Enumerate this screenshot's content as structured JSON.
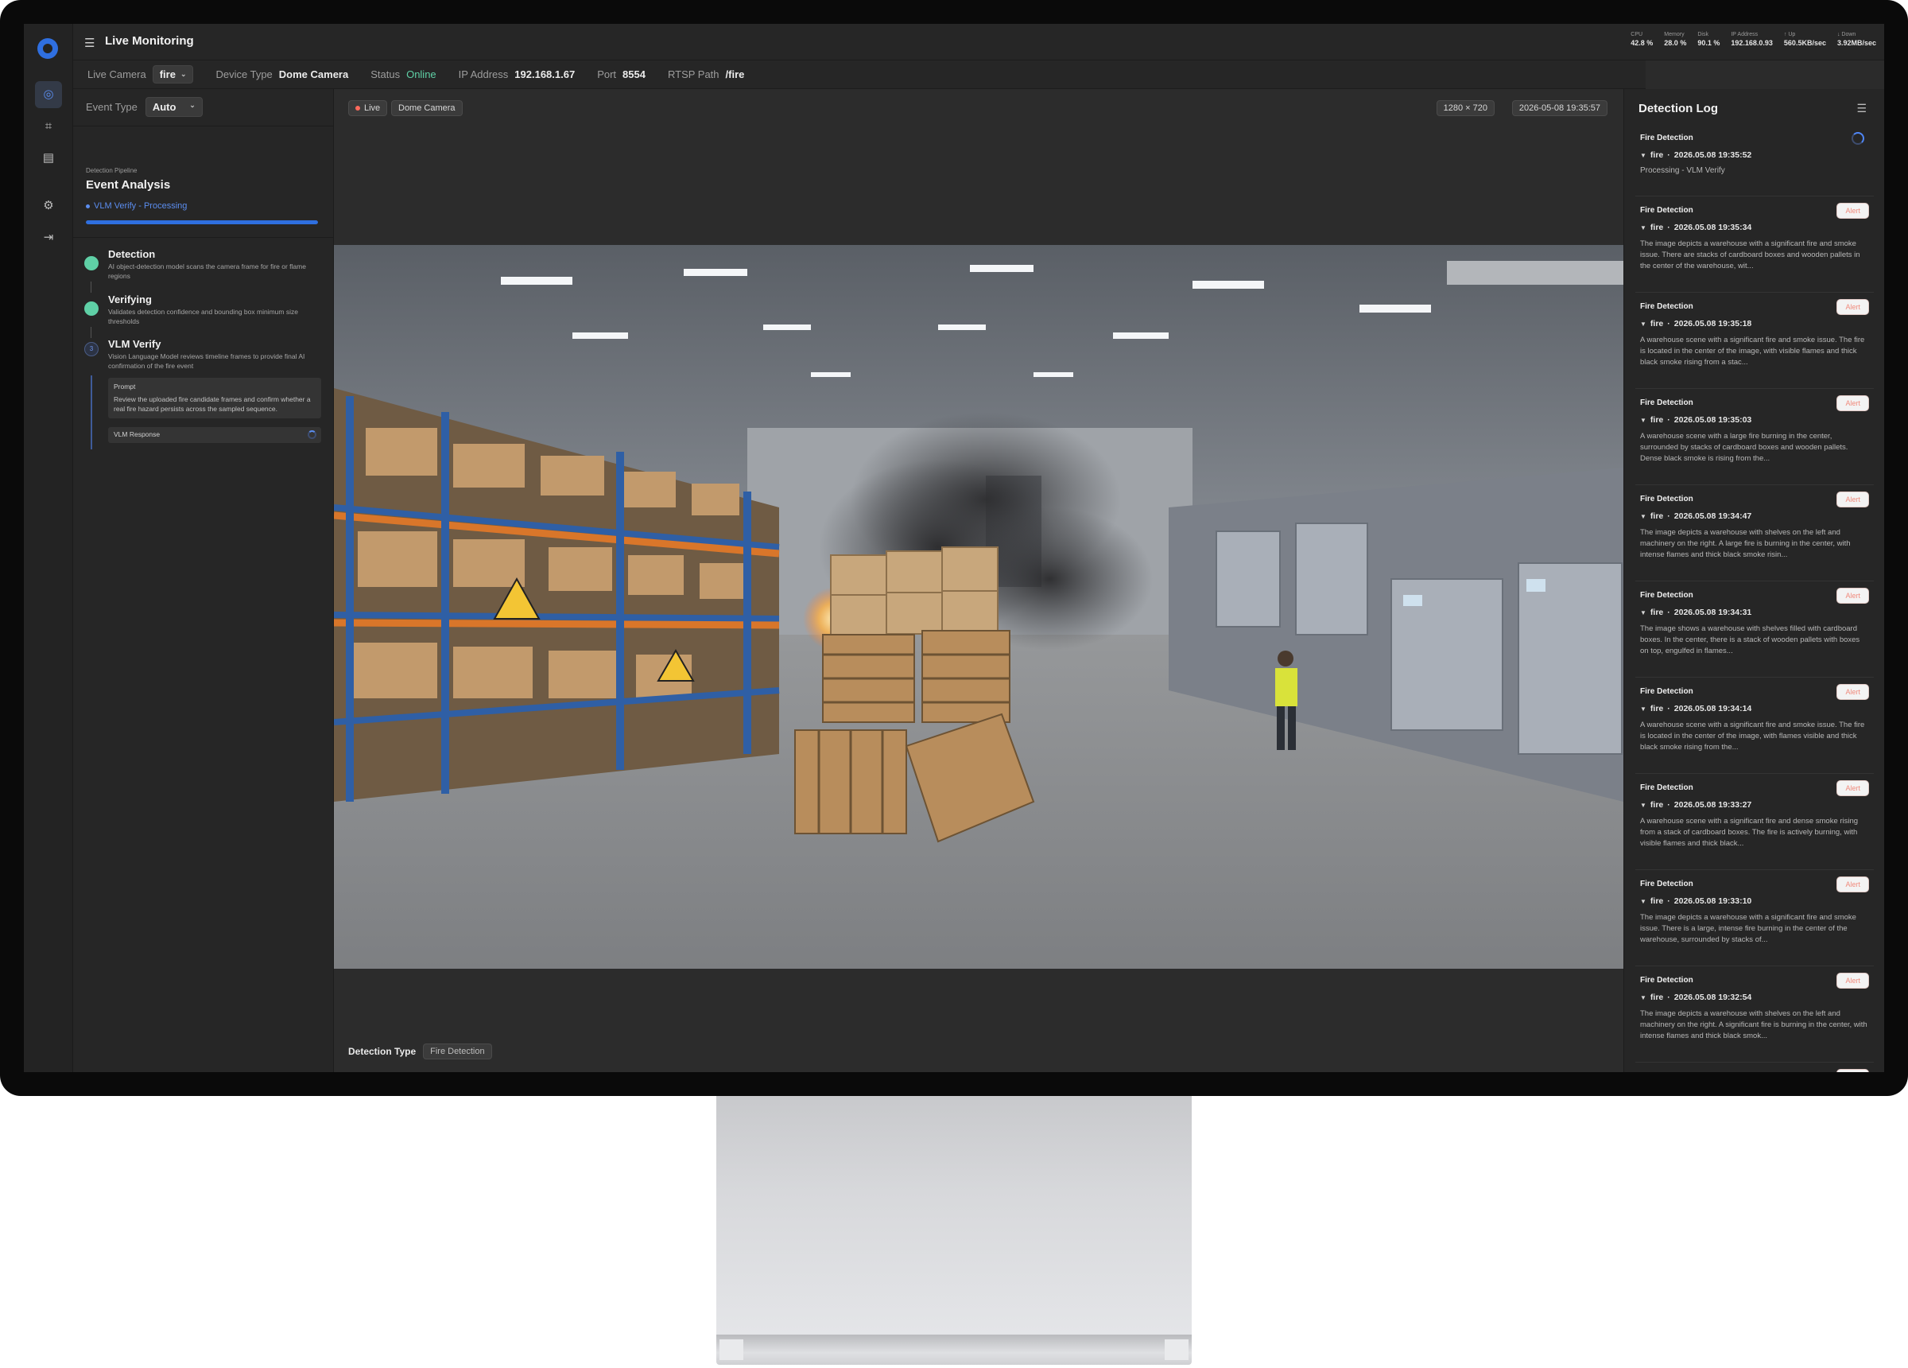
{
  "app": {
    "title": "Live Monitoring"
  },
  "system_stats": [
    {
      "label": "CPU",
      "value": "42.8 %"
    },
    {
      "label": "Memory",
      "value": "28.0 %"
    },
    {
      "label": "Disk",
      "value": "90.1 %"
    },
    {
      "label": "IP Address",
      "value": "192.168.0.93"
    },
    {
      "label": "↑ Up",
      "value": "560.5KB/sec"
    },
    {
      "label": "↓ Down",
      "value": "3.92MB/sec"
    }
  ],
  "camera_info": {
    "live_camera_label": "Live Camera",
    "live_camera_value": "fire",
    "device_type_label": "Device Type",
    "device_type_value": "Dome Camera",
    "status_label": "Status",
    "status_value": "Online",
    "ip_label": "IP Address",
    "ip_value": "192.168.1.67",
    "port_label": "Port",
    "port_value": "8554",
    "rtsp_label": "RTSP Path",
    "rtsp_value": "/fire"
  },
  "left_panel": {
    "event_type_label": "Event Type",
    "event_type_value": "Auto",
    "pipeline_kicker": "Detection Pipeline",
    "pipeline_title": "Event Analysis",
    "pipeline_status": "VLM Verify - Processing",
    "progress_fraction": 1.0,
    "steps": [
      {
        "name": "Detection",
        "desc": "AI object-detection model scans the camera frame for fire or flame regions",
        "state": "done"
      },
      {
        "name": "Verifying",
        "desc": "Validates detection confidence and bounding box minimum size thresholds",
        "state": "done"
      },
      {
        "name": "VLM Verify",
        "desc": "Vision Language Model reviews timeline frames to provide final AI confirmation of the fire event",
        "state": "current",
        "number": "3"
      }
    ],
    "prompt_label": "Prompt",
    "prompt_text": "Review the uploaded fire candidate frames and confirm whether a real fire hazard persists across the sampled sequence.",
    "vlm_response_label": "VLM Response"
  },
  "video": {
    "live_tag": "Live",
    "camera_tag": "Dome Camera",
    "resolution": "1280 × 720",
    "timestamp": "2026-05-08 19:35:57",
    "detection_type_label": "Detection Type",
    "detection_type_value": "Fire Detection"
  },
  "detection_log": {
    "title": "Detection Log",
    "alert_label": "Alert",
    "items": [
      {
        "title": "Fire Detection",
        "camera": "fire",
        "time": "2026.05.08 19:35:52",
        "status": "Processing - VLM Verify",
        "processing": true
      },
      {
        "title": "Fire Detection",
        "camera": "fire",
        "time": "2026.05.08 19:35:34",
        "text": "The image depicts a warehouse with a significant fire and smoke issue. There are stacks of cardboard boxes and wooden pallets in the center of the warehouse, wit..."
      },
      {
        "title": "Fire Detection",
        "camera": "fire",
        "time": "2026.05.08 19:35:18",
        "text": "A warehouse scene with a significant fire and smoke issue. The fire is located in the center of the image, with visible flames and thick black smoke rising from a stac..."
      },
      {
        "title": "Fire Detection",
        "camera": "fire",
        "time": "2026.05.08 19:35:03",
        "text": "A warehouse scene with a large fire burning in the center, surrounded by stacks of cardboard boxes and wooden pallets. Dense black smoke is rising from the..."
      },
      {
        "title": "Fire Detection",
        "camera": "fire",
        "time": "2026.05.08 19:34:47",
        "text": "The image depicts a warehouse with shelves on the left and machinery on the right. A large fire is burning in the center, with intense flames and thick black smoke risin..."
      },
      {
        "title": "Fire Detection",
        "camera": "fire",
        "time": "2026.05.08 19:34:31",
        "text": "The image shows a warehouse with shelves filled with cardboard boxes. In the center, there is a stack of wooden pallets with boxes on top, engulfed in flames..."
      },
      {
        "title": "Fire Detection",
        "camera": "fire",
        "time": "2026.05.08 19:34:14",
        "text": "A warehouse scene with a significant fire and smoke issue. The fire is located in the center of the image, with flames visible and thick black smoke rising from the..."
      },
      {
        "title": "Fire Detection",
        "camera": "fire",
        "time": "2026.05.08 19:33:27",
        "text": "A warehouse scene with a significant fire and dense smoke rising from a stack of cardboard boxes. The fire is actively burning, with visible flames and thick black..."
      },
      {
        "title": "Fire Detection",
        "camera": "fire",
        "time": "2026.05.08 19:33:10",
        "text": "The image depicts a warehouse with a significant fire and smoke issue. There is a large, intense fire burning in the center of the warehouse, surrounded by stacks of..."
      },
      {
        "title": "Fire Detection",
        "camera": "fire",
        "time": "2026.05.08 19:32:54",
        "text": "The image depicts a warehouse with shelves on the left and machinery on the right. A significant fire is burning in the center, with intense flames and thick black smok..."
      },
      {
        "title": "Fire Detection"
      }
    ]
  },
  "colors": {
    "accent": "#2f6fe0",
    "online": "#5fd0a6",
    "alert": "#f08a7c",
    "live_dot": "#ff6a5c"
  }
}
